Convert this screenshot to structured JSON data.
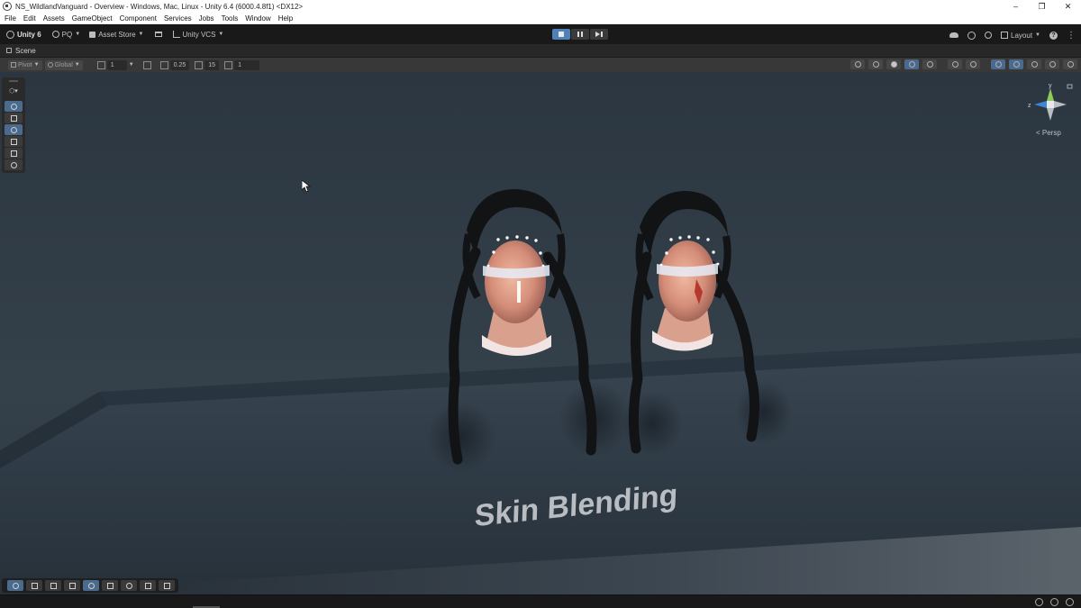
{
  "window": {
    "title": "NS_WildlandVanguard - Overview - Windows, Mac, Linux - Unity 6.4 (6000.4.8f1) <DX12>",
    "controls": {
      "minimize": "–",
      "restore": "❐",
      "close": "✕"
    }
  },
  "menu": [
    "File",
    "Edit",
    "Assets",
    "GameObject",
    "Component",
    "Services",
    "Jobs",
    "Tools",
    "Window",
    "Help"
  ],
  "toolbar": {
    "unity_label": "Unity 6",
    "account_label": "PQ",
    "asset_store_label": "Asset Store",
    "vcs_label": "Unity VCS",
    "layout_label": "Layout"
  },
  "scene_tab": {
    "label": "Scene"
  },
  "scene_toolbar": {
    "pivot_label": "Pivot",
    "global_label": "Global",
    "grid_snap_value": "1",
    "increment_value": "0.25",
    "rotation_snap_value": "15",
    "scale_snap_value": "1"
  },
  "gizmo": {
    "y_label": "y",
    "z_label": "z",
    "view_label": "< Persp"
  },
  "scene": {
    "floor_text": "Skin Blending",
    "colors": {
      "sky": "#2f3a43",
      "floor": "#2e3a44",
      "skin": "#e2a08a",
      "hair": "#111214",
      "paint": "#f5f8ff"
    }
  }
}
